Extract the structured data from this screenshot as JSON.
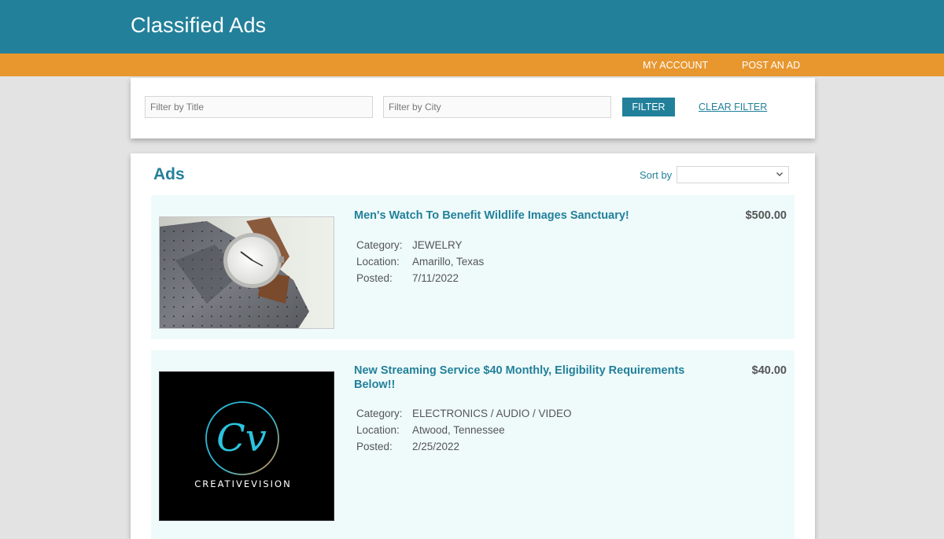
{
  "header": {
    "brand": "Classified Ads"
  },
  "nav": {
    "my_account": "MY ACCOUNT",
    "post_ad": "POST AN AD"
  },
  "filters": {
    "title_placeholder": "Filter by Title",
    "title_value": "",
    "city_placeholder": "Filter by City",
    "city_value": "",
    "filter_button": "FILTER",
    "clear_link": "CLEAR FILTER"
  },
  "ads_section": {
    "heading": "Ads",
    "sort_label": "Sort by",
    "sort_value": ""
  },
  "ads": [
    {
      "title": "Men's Watch To Benefit Wildlife Images Sanctuary!",
      "price": "$500.00",
      "category_label": "Category:",
      "category": "JEWELRY",
      "location_label": "Location:",
      "location": "Amarillo, Texas",
      "posted_label": "Posted:",
      "posted": "7/11/2022",
      "image": "watch-on-tie-photo"
    },
    {
      "title": "New Streaming Service $40 Monthly, Eligibility Requirements Below!!",
      "price": "$40.00",
      "category_label": "Category:",
      "category": "ELECTRONICS / AUDIO / VIDEO",
      "location_label": "Location:",
      "location": "Atwood, Tennessee",
      "posted_label": "Posted:",
      "posted": "2/25/2022",
      "image": "creative-vision-logo",
      "logo_text": "CREATIVEVISION",
      "logo_monogram": "Cv"
    }
  ],
  "colors": {
    "brand_teal": "#23809a",
    "nav_orange": "#e8972f",
    "page_bg": "#e3e3e3",
    "ad_bg": "#effbfb"
  }
}
